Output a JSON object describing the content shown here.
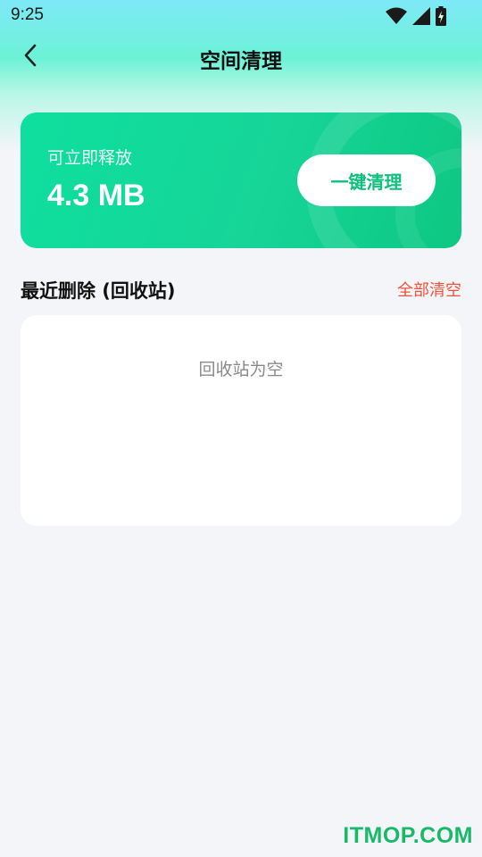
{
  "status_bar": {
    "time": "9:25",
    "icons": [
      "wifi-icon",
      "signal-icon",
      "battery-charging-icon"
    ]
  },
  "nav": {
    "title": "空间清理",
    "back_icon": "chevron-left-icon"
  },
  "hero": {
    "label": "可立即释放",
    "size": "4.3 MB",
    "button_label": "一键清理"
  },
  "recycle_bin": {
    "title": "最近删除 (回收站)",
    "clear_all_label": "全部清空",
    "empty_text": "回收站为空"
  },
  "watermark": {
    "text": "ITMOP.COM"
  },
  "colors": {
    "accent_green": "#0fbf7d",
    "danger_red": "#f2533c",
    "background": "#f4f5f8"
  }
}
